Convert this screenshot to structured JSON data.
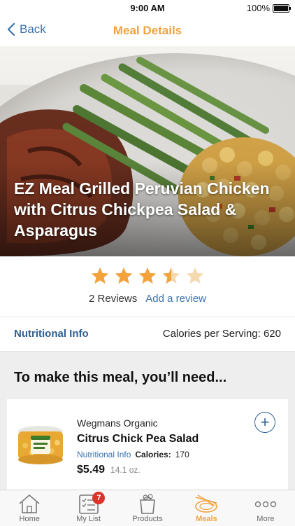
{
  "status_bar": {
    "time": "9:00 AM",
    "battery": "100%"
  },
  "nav": {
    "back_label": "Back",
    "title": "Meal Details"
  },
  "meal": {
    "title": "EZ Meal Grilled Peruvian Chicken with Citrus Chickpea Salad & Asparagus"
  },
  "rating": {
    "stars": 3.5,
    "max_stars": 5,
    "reviews_label": "2 Reviews",
    "add_review_label": "Add a review"
  },
  "nutrition": {
    "link_label": "Nutritional Info",
    "calories_label": "Calories per Serving: 620"
  },
  "ingredients": {
    "title": "To make this meal, you’ll need...",
    "items": [
      {
        "brand": "Wegmans Organic",
        "name": "Citrus Chick Pea Salad",
        "nutri_label": "Nutritional Info",
        "calories_label": "Calories:",
        "calories_value": "170",
        "price": "$5.49",
        "size": "14.1 oz."
      }
    ]
  },
  "tabs": [
    {
      "label": "Home",
      "icon": "home-icon"
    },
    {
      "label": "My List",
      "icon": "list-icon",
      "badge": "7"
    },
    {
      "label": "Products",
      "icon": "products-icon"
    },
    {
      "label": "Meals",
      "icon": "meals-icon",
      "active": true
    },
    {
      "label": "More",
      "icon": "more-icon"
    }
  ],
  "colors": {
    "accent": "#f0a240",
    "link": "#3b73ad",
    "star": "#f4a23b",
    "star_empty": "#f7d9b0",
    "badge": "#d9342b"
  }
}
